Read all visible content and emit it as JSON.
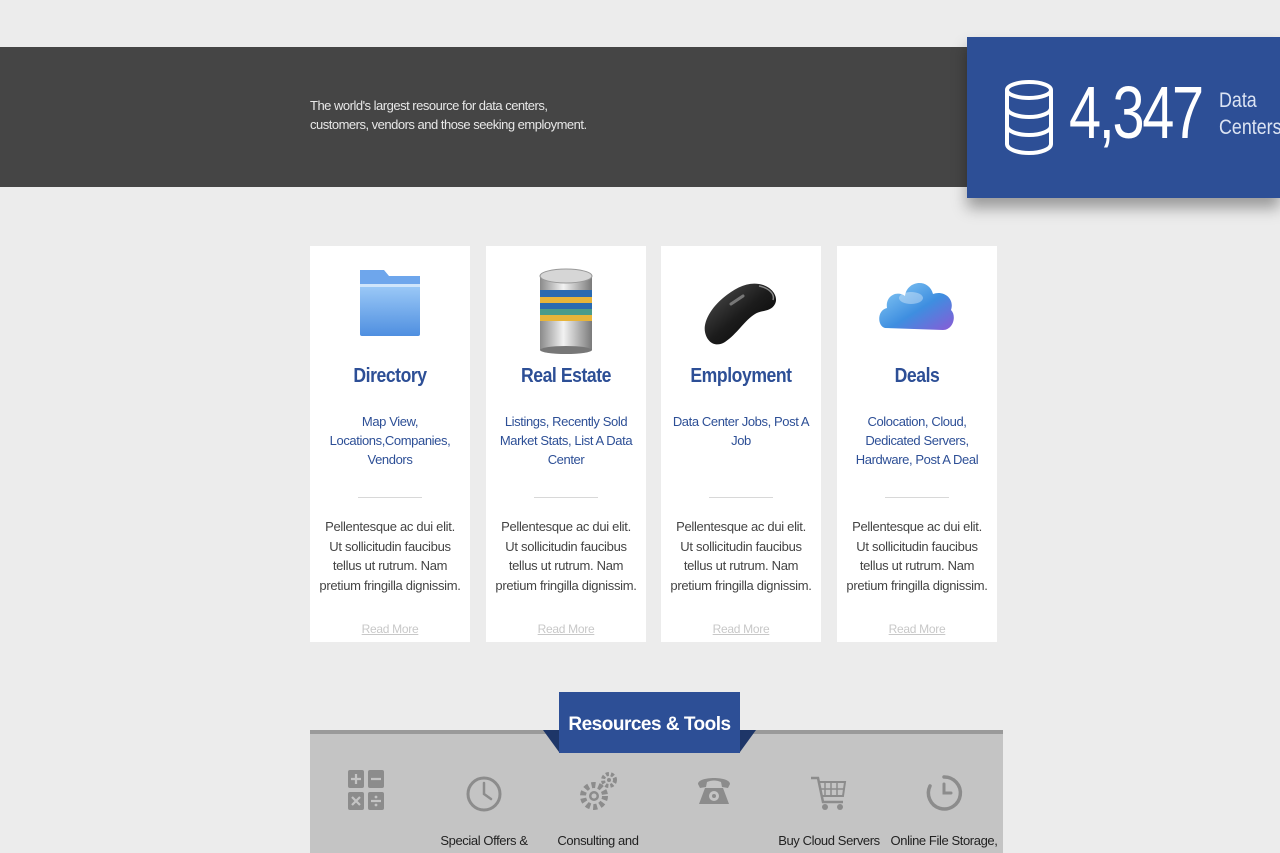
{
  "hero": {
    "tagline_line1": "The world's largest resource for data centers,",
    "tagline_line2": "customers, vendors and those seeking employment."
  },
  "counter": {
    "count": "4,347",
    "unit_line1": "Data",
    "unit_line2": "Centers",
    "icon": "database-icon",
    "bg_color": "#2d4f96"
  },
  "cards": [
    {
      "title": "Directory",
      "links": "Map View, Locations,Companies, Vendors",
      "description": "Pellentesque ac dui elit. Ut sollicitudin faucibus tellus ut rutrum. Nam pretium fringilla dignissim.",
      "more": "Read More",
      "icon": "folder-icon"
    },
    {
      "title": "Real Estate",
      "links": "Listings, Recently Sold Market Stats, List A Data Center",
      "description": "Pellentesque ac dui elit. Ut sollicitudin faucibus tellus ut rutrum. Nam pretium fringilla dignissim.",
      "more": "Read More",
      "icon": "database-stack-icon"
    },
    {
      "title": "Employment",
      "links": "Data Center Jobs, Post A Job",
      "description": "Pellentesque ac dui elit. Ut sollicitudin faucibus tellus ut rutrum. Nam pretium fringilla dignissim.",
      "more": "Read More",
      "icon": "mouse-icon"
    },
    {
      "title": "Deals",
      "links": "Colocation, Cloud, Dedicated Servers, Hardware, Post A Deal",
      "description": "Pellentesque ac dui elit. Ut sollicitudin faucibus tellus ut rutrum. Nam pretium fringilla dignissim.",
      "more": "Read More",
      "icon": "cloud-icon"
    }
  ],
  "resources": {
    "title": "Resources & Tools",
    "tools": [
      {
        "label": "",
        "icon": "calculator-icon"
      },
      {
        "label": "Special Offers &",
        "icon": "clock-icon"
      },
      {
        "label": "Consulting and",
        "icon": "gears-icon"
      },
      {
        "label": "",
        "icon": "telephone-icon"
      },
      {
        "label": "Buy Cloud Servers",
        "icon": "cart-icon"
      },
      {
        "label": "Online File Storage,",
        "icon": "timer-icon"
      }
    ]
  },
  "colors": {
    "accent": "#2d4f96",
    "hero_bg": "#454545",
    "page_bg": "#ececec",
    "resources_bg": "#c4c4c4"
  }
}
